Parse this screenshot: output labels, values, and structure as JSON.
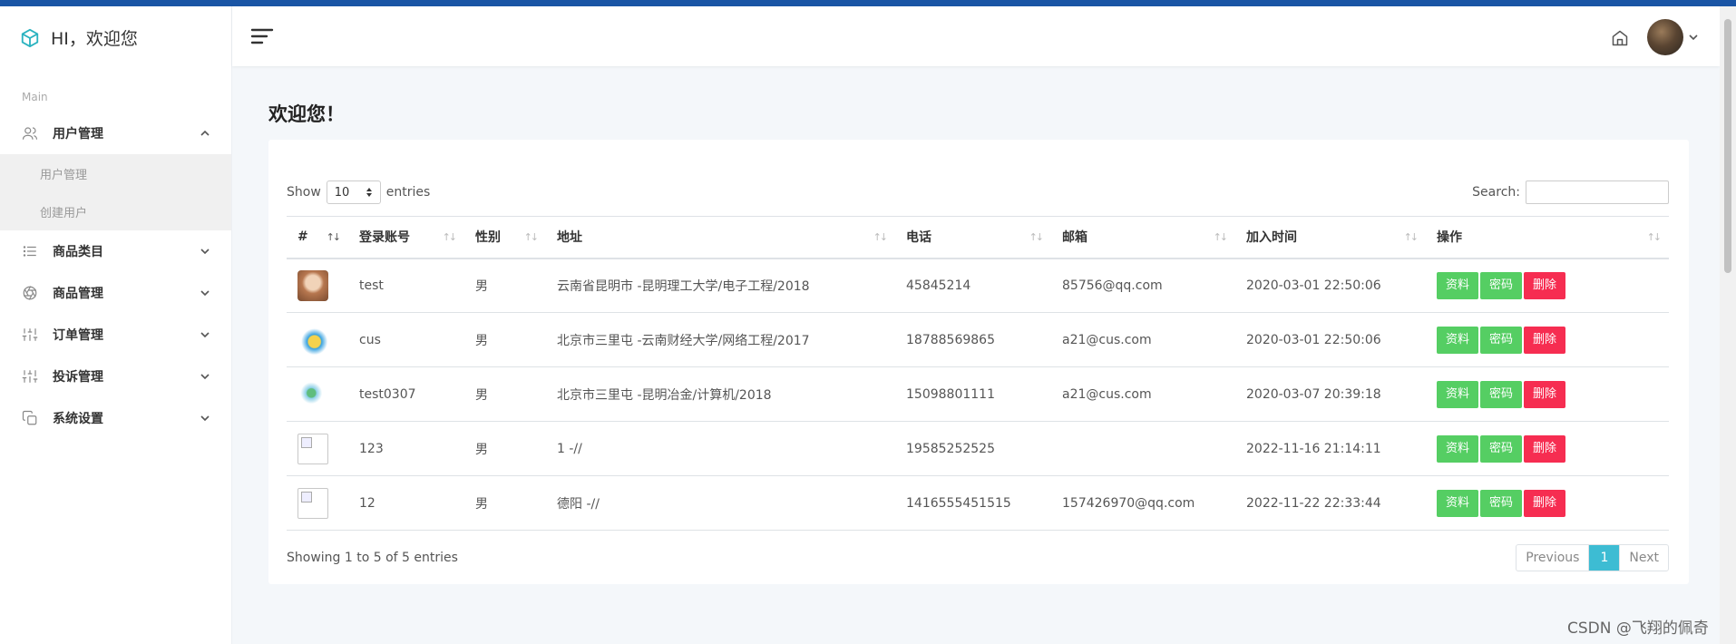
{
  "sidebar": {
    "brand": "HI，欢迎您",
    "section_label": "Main",
    "menu": [
      {
        "label": "用户管理",
        "icon": "users-icon",
        "expanded": true,
        "children": [
          "用户管理",
          "创建用户"
        ]
      },
      {
        "label": "商品类目",
        "icon": "list-icon",
        "expanded": false
      },
      {
        "label": "商品管理",
        "icon": "aperture-icon",
        "expanded": false
      },
      {
        "label": "订单管理",
        "icon": "sliders-icon",
        "expanded": false
      },
      {
        "label": "投诉管理",
        "icon": "sliders-icon",
        "expanded": false
      },
      {
        "label": "系统设置",
        "icon": "copy-icon",
        "expanded": false
      }
    ]
  },
  "header": {
    "menu_icon": "hamburger-icon",
    "home_icon": "home-icon"
  },
  "page": {
    "title": "欢迎您！"
  },
  "table_controls": {
    "show_label": "Show",
    "entries_value": "10",
    "entries_label": "entries",
    "search_label": "Search:",
    "search_value": ""
  },
  "table": {
    "columns": [
      "#",
      "登录账号",
      "性别",
      "地址",
      "电话",
      "邮箱",
      "加入时间",
      "操作"
    ],
    "rows": [
      {
        "account": "test",
        "gender": "男",
        "address": "云南省昆明市 -昆明理工大学/电子工程/2018",
        "phone": "45845214",
        "email": "85756@qq.com",
        "joined": "2020-03-01 22:50:06"
      },
      {
        "account": "cus",
        "gender": "男",
        "address": "北京市三里屯 -云南财经大学/网络工程/2017",
        "phone": "18788569865",
        "email": "a21@cus.com",
        "joined": "2020-03-01 22:50:06"
      },
      {
        "account": "test0307",
        "gender": "男",
        "address": "北京市三里屯 -昆明冶金/计算机/2018",
        "phone": "15098801111",
        "email": "a21@cus.com",
        "joined": "2020-03-07 20:39:18"
      },
      {
        "account": "123",
        "gender": "男",
        "address": "1 -//",
        "phone": "19585252525",
        "email": "",
        "joined": "2022-11-16 21:14:11"
      },
      {
        "account": "12",
        "gender": "男",
        "address": "德阳 -//",
        "phone": "1416555451515",
        "email": "157426970@qq.com",
        "joined": "2022-11-22 22:33:44"
      }
    ],
    "actions": {
      "profile": "资料",
      "password": "密码",
      "delete": "删除"
    }
  },
  "footer": {
    "info": "Showing 1 to 5 of 5 entries",
    "prev": "Previous",
    "page": "1",
    "next": "Next"
  },
  "watermark": "CSDN @飞翔的佩奇",
  "colors": {
    "topbar": "#1a55a5",
    "green": "#55ce63",
    "red": "#f62d51",
    "page_active": "#3dbcd3"
  }
}
